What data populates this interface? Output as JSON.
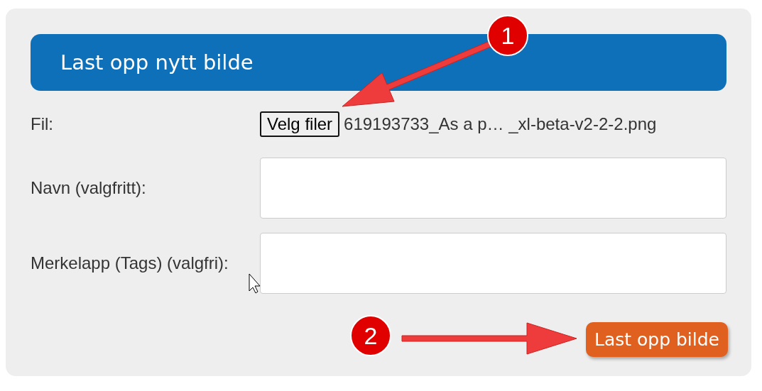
{
  "panel": {
    "title": "Last opp nytt bilde"
  },
  "fields": [
    {
      "kind": "file",
      "label": "Fil:",
      "button": "Velg filer",
      "filename": "619193733_As a p… _xl-beta-v2-2-2.png"
    },
    {
      "kind": "text",
      "label": "Navn (valgfritt):"
    },
    {
      "kind": "text",
      "label": "Merkelapp (Tags) (valgfri):"
    }
  ],
  "submit": {
    "label": "Last opp bilde"
  },
  "annotations": [
    {
      "number": "1"
    },
    {
      "number": "2"
    }
  ]
}
